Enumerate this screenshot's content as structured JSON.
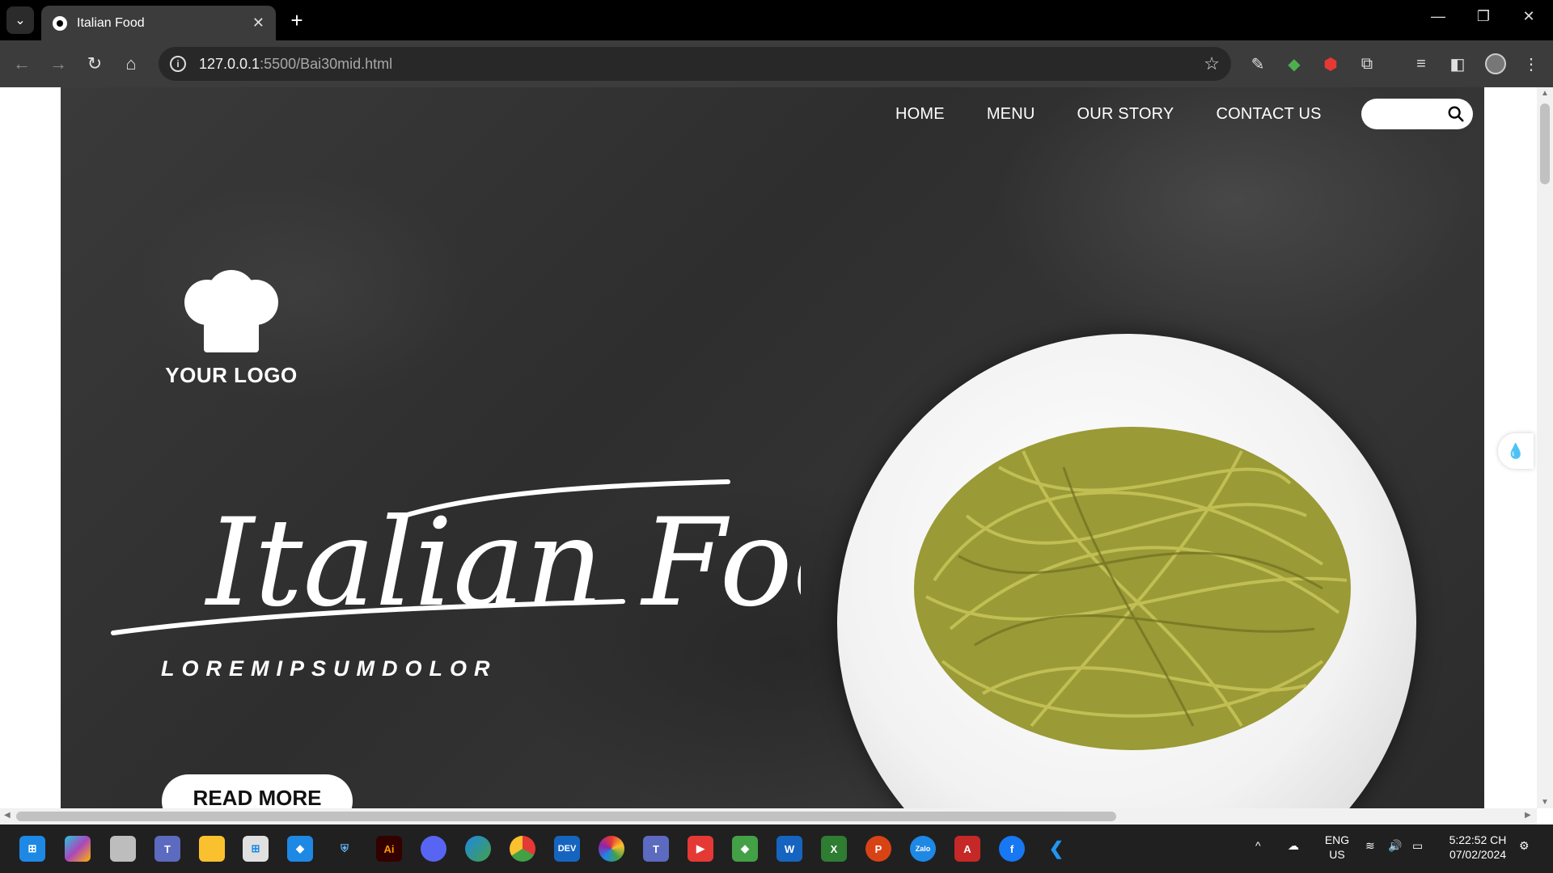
{
  "browser": {
    "tab_title": "Italian Food",
    "url_host": "127.0.0.1",
    "url_path": ":5500/Bai30mid.html"
  },
  "page": {
    "nav": [
      "HOME",
      "MENU",
      "OUR STORY",
      "CONTACT US"
    ],
    "logo_text": "YOUR LOGO",
    "hero_title": "Italian Food",
    "tagline": "LOREMIPSUMDOLOR",
    "read_more": "READ MORE"
  },
  "taskbar": {
    "lang_top": "ENG",
    "lang_bottom": "US",
    "time": "5:22:52 CH",
    "date": "07/02/2024",
    "apps": [
      "windows-start",
      "copilot",
      "task-view",
      "teams",
      "file-explorer",
      "store",
      "dropbox",
      "security",
      "illustrator",
      "discord",
      "edge",
      "chrome",
      "devhome",
      "colors",
      "teams-2",
      "youtube",
      "git",
      "word",
      "excel",
      "powerpoint",
      "zalo",
      "access",
      "facebook",
      "vscode"
    ]
  },
  "colors": {
    "hero_bg": "#333333",
    "pasta": "#a3a23b",
    "browser_chrome": "#3c3c3c"
  }
}
